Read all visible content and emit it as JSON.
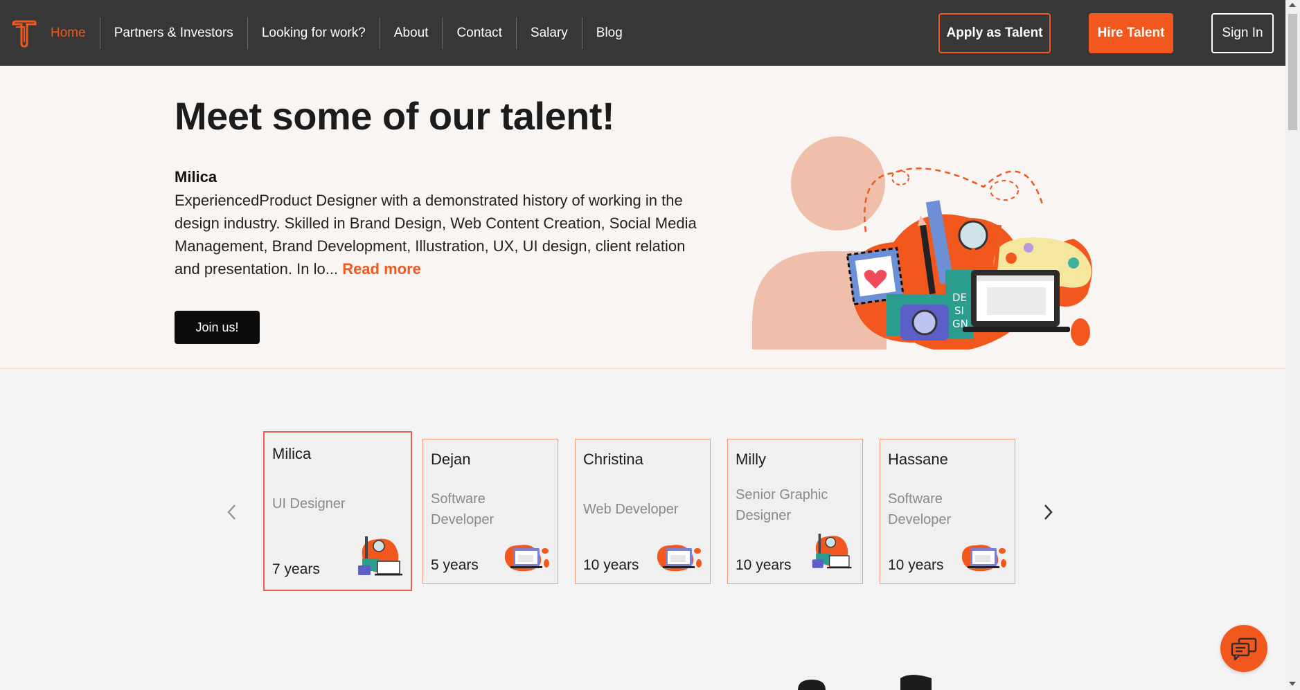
{
  "nav": {
    "links": [
      "Home",
      "Partners & Investors",
      "Looking for work?",
      "About",
      "Contact",
      "Salary",
      "Blog"
    ],
    "apply_label": "Apply as Talent",
    "hire_label": "Hire Talent",
    "signin_label": "Sign In"
  },
  "hero": {
    "title": "Meet some of our talent!",
    "name": "Milica",
    "description": "ExperiencedProduct Designer with a demonstrated history of working in the design industry. Skilled in Brand Design, Web Content Creation, Social Media Management, Brand Development, Illustration, UX, UI design, client relation and presentation. In lo...",
    "read_more": "Read more",
    "join_label": "Join us!",
    "illustration_text": "DE SI GN"
  },
  "talents": [
    {
      "name": "Milica",
      "role": "UI Designer",
      "years": "7 years",
      "icon": "design-tools-icon",
      "active": true
    },
    {
      "name": "Dejan",
      "role": "Software Developer",
      "years": "5 years",
      "icon": "laptop-icon",
      "active": false
    },
    {
      "name": "Christina",
      "role": "Web Developer",
      "years": "10 years",
      "icon": "laptop-icon",
      "active": false
    },
    {
      "name": "Milly",
      "role": "Senior Graphic Designer",
      "years": "10 years",
      "icon": "design-tools-icon",
      "active": false
    },
    {
      "name": "Hassane",
      "role": "Software Developer",
      "years": "10 years",
      "icon": "laptop-icon",
      "active": false
    }
  ],
  "colors": {
    "accent": "#f2571d",
    "nav_bg": "#373737",
    "hero_bg": "#f9f5f3",
    "card_bg": "#f1f0f0",
    "card_border": "#f49a7a"
  }
}
